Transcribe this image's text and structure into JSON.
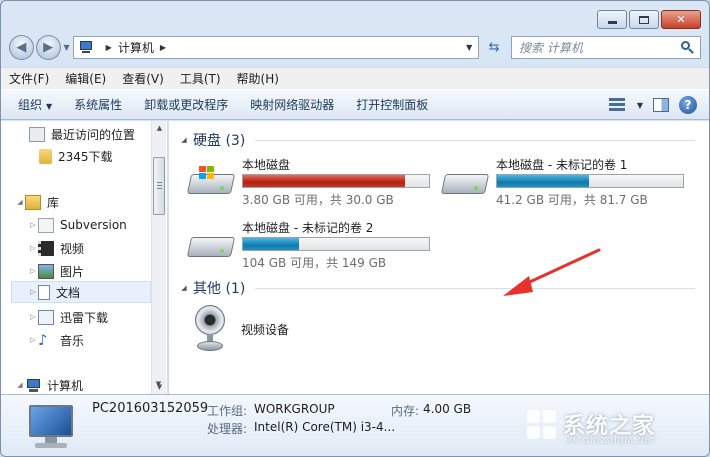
{
  "window": {
    "controls": {
      "minimize": "",
      "maximize": "",
      "close": "✕"
    }
  },
  "address_bar": {
    "crumb": "计算机",
    "search_placeholder": "搜索 计算机"
  },
  "menu": [
    "文件(F)",
    "编辑(E)",
    "查看(V)",
    "工具(T)",
    "帮助(H)"
  ],
  "toolbar": {
    "organize": "组织",
    "items": [
      "系统属性",
      "卸载或更改程序",
      "映射网络驱动器",
      "打开控制面板"
    ]
  },
  "nav": {
    "items": [
      {
        "label": "最近访问的位置",
        "icon": "recent-places-icon"
      },
      {
        "label": "2345下载",
        "icon": "folder-icon"
      },
      {
        "label": "库",
        "icon": "library-icon"
      },
      {
        "label": "Subversion",
        "icon": "subversion-icon"
      },
      {
        "label": "视频",
        "icon": "video-icon"
      },
      {
        "label": "图片",
        "icon": "pictures-icon"
      },
      {
        "label": "文档",
        "icon": "documents-icon"
      },
      {
        "label": "迅雷下载",
        "icon": "xunlei-icon"
      },
      {
        "label": "音乐",
        "icon": "music-icon"
      },
      {
        "label": "计算机",
        "icon": "computer-icon"
      }
    ]
  },
  "content": {
    "groups": [
      {
        "title": "硬盘 (3)"
      },
      {
        "title": "其他 (1)"
      }
    ],
    "drives": [
      {
        "name": "本地磁盘",
        "size_text": "3.80 GB 可用，共 30.0 GB",
        "used_fraction": 0.873,
        "bar_color": "#b0200e"
      },
      {
        "name": "本地磁盘 - 未标记的卷 1",
        "size_text": "41.2 GB 可用，共 81.7 GB",
        "used_fraction": 0.496,
        "bar_color": "#0f7aad"
      },
      {
        "name": "本地磁盘 - 未标记的卷 2",
        "size_text": "104 GB 可用，共 149 GB",
        "used_fraction": 0.302,
        "bar_color": "#0f7aad"
      }
    ],
    "other_devices": [
      {
        "name": "视频设备",
        "icon": "webcam-icon"
      }
    ]
  },
  "details": {
    "name": "PC201603152059",
    "workgroup_label": "工作组:",
    "workgroup_value": "WORKGROUP",
    "memory_label": "内存:",
    "memory_value": "4.00 GB",
    "cpu_label": "处理器:",
    "cpu_value": "Intel(R) Core(TM) i3-4..."
  },
  "watermark": {
    "text": "系统之家",
    "sub": "XITONGZHIJIA.NET"
  },
  "colors": {
    "accent": "#1e395b",
    "drive_full": "#b0200e",
    "drive_normal": "#0f7aad",
    "annotation_arrow": "#e8312a"
  }
}
